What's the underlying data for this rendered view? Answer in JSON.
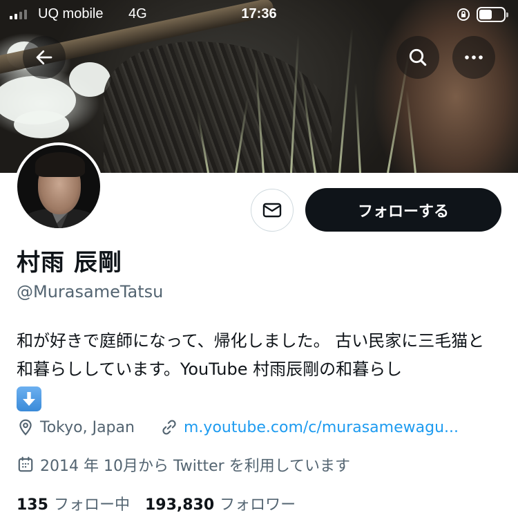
{
  "status_bar": {
    "carrier": "UQ mobile",
    "network": "4G",
    "time": "17:36"
  },
  "nav": {
    "back_icon": "arrow-left-icon",
    "search_icon": "search-icon",
    "more_icon": "more-horizontal-icon"
  },
  "profile": {
    "display_name": "村雨 辰剛",
    "handle": "@MurasameTatsu",
    "bio": "和が好きで庭師になって、帰化しました。 古い民家に三毛猫と和暮らししています。YouTube 村雨辰剛の和暮らし",
    "bio_emoji": "down-arrow-emoji",
    "location": "Tokyo, Japan",
    "link": "m.youtube.com/c/murasamewagu...",
    "joined": "2014 年 10月から Twitter を利用しています"
  },
  "actions": {
    "message_icon": "envelope-icon",
    "follow_label": "フォローする"
  },
  "stats": {
    "following_count": "135",
    "following_label": "フォロー中",
    "followers_count": "193,830",
    "followers_label": "フォロワー"
  },
  "colors": {
    "text_primary": "#0f1419",
    "text_secondary": "#536471",
    "link": "#1d9bf0",
    "follow_bg": "#0f1419"
  }
}
